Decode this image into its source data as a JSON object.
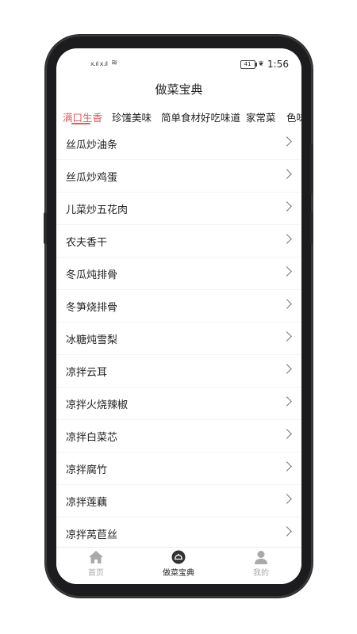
{
  "status": {
    "time": "1:56",
    "battery": "41",
    "signal": "x.ıl x.ıl",
    "wifi": "≋"
  },
  "header": {
    "title": "做菜宝典"
  },
  "tabs": [
    {
      "label": "满口生香",
      "active": true
    },
    {
      "label": "珍馐美味",
      "active": false
    },
    {
      "label": "简单食材好吃味道",
      "active": false
    },
    {
      "label": "家常菜",
      "active": false
    },
    {
      "label": "色味",
      "active": false
    }
  ],
  "list": [
    "丝瓜炒油条",
    "丝瓜炒鸡蛋",
    "儿菜炒五花肉",
    "农夫香干",
    "冬瓜炖排骨",
    "冬笋烧排骨",
    "冰糖炖雪梨",
    "凉拌云耳",
    "凉拌火烧辣椒",
    "凉拌白菜芯",
    "凉拌腐竹",
    "凉拌莲藕",
    "凉拌莴苣丝"
  ],
  "bottom_nav": [
    {
      "label": "首页",
      "icon": "home-icon",
      "active": false
    },
    {
      "label": "做菜宝典",
      "icon": "cloche-icon",
      "active": true
    },
    {
      "label": "我的",
      "icon": "user-icon",
      "active": false
    }
  ],
  "colors": {
    "accent": "#e05a5a",
    "divider": "#f4f4f4",
    "inactive": "#aaaaaa"
  }
}
